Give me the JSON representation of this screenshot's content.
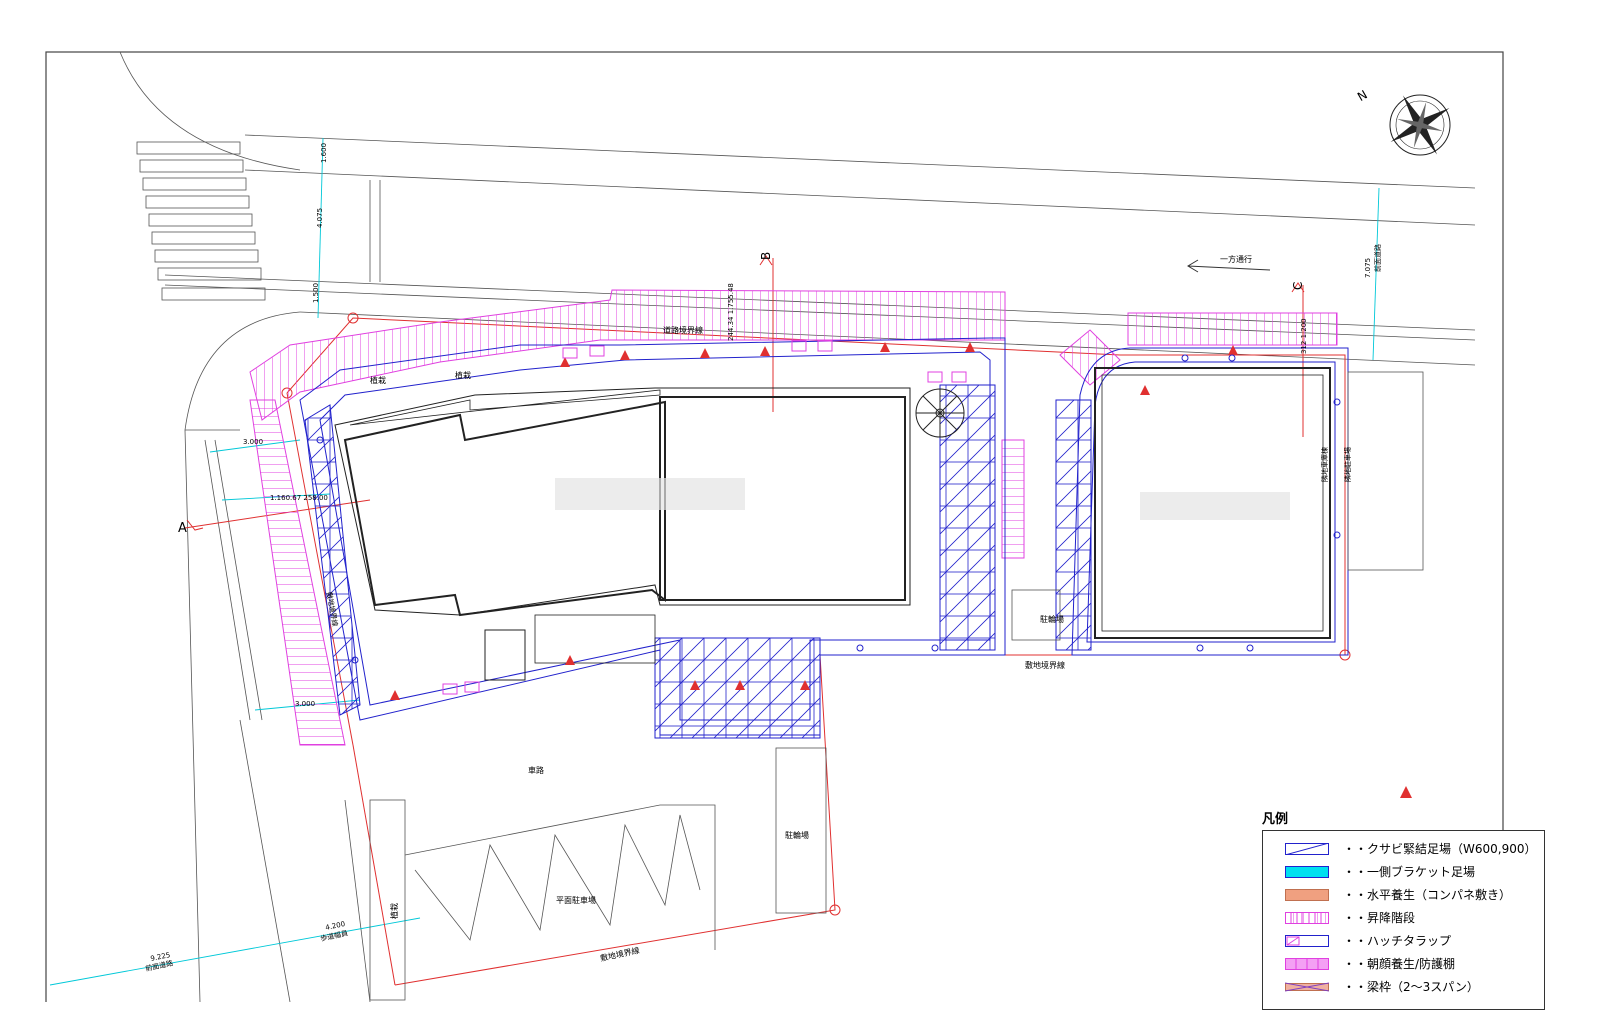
{
  "labels": {
    "section_a": "A",
    "section_b": "B",
    "section_c": "C",
    "north": "N",
    "one_way": "一方通行",
    "road_boundary": "道路境界線",
    "site_boundary_east": "敷地境界線",
    "site_boundary_south": "敷地境界線",
    "car_path": "車路",
    "parking_flat": "平面駐車場",
    "bike_parking_1": "駐輪場",
    "bike_parking_2": "駐輪場",
    "planting_1": "植栽",
    "planting_2": "植栽",
    "planting_3": "植栽",
    "neighbor_parking": "隣地駐車場",
    "neighbor_building": "隣地車庫棟",
    "sidewalk_width": "歩道幅員",
    "front_road": "前面道路",
    "front_road_2": "前面道路",
    "left_boundary": "敷地境界線"
  },
  "dimensions": {
    "d1600": "1.600",
    "d4075": "4.075",
    "d1500": "1.500",
    "d3000": "3.000",
    "d3000b": "3.000",
    "d4200": "4.200",
    "d9225": "9.225",
    "d7075": "7.075",
    "d_b_top": "244.34 1.755.48",
    "d_a_left": "1.160.67 258.00",
    "d_c_top": "312 1.200"
  },
  "legend": {
    "title": "凡例",
    "items": [
      {
        "label": "・・クサビ緊結足場（W600,900）",
        "icon": "wedge-scaffold-icon"
      },
      {
        "label": "・・一側ブラケット足場",
        "icon": "bracket-scaffold-icon"
      },
      {
        "label": "・・水平養生（コンパネ敷き）",
        "icon": "horizontal-protection-icon"
      },
      {
        "label": "・・昇降階段",
        "icon": "stairs-icon"
      },
      {
        "label": "・・ハッチタラップ",
        "icon": "hatch-ladder-icon"
      },
      {
        "label": "・・朝顔養生/防護棚",
        "icon": "protective-shelf-icon"
      },
      {
        "label": "・・梁枠（2～3スパン）",
        "icon": "beam-frame-icon"
      }
    ]
  },
  "colors": {
    "scaffold": "#2222cc",
    "pink": "#e040e0",
    "red": "#e03030",
    "cyan": "#00c8d8",
    "orange": "#f0a080",
    "line": "#444444"
  }
}
